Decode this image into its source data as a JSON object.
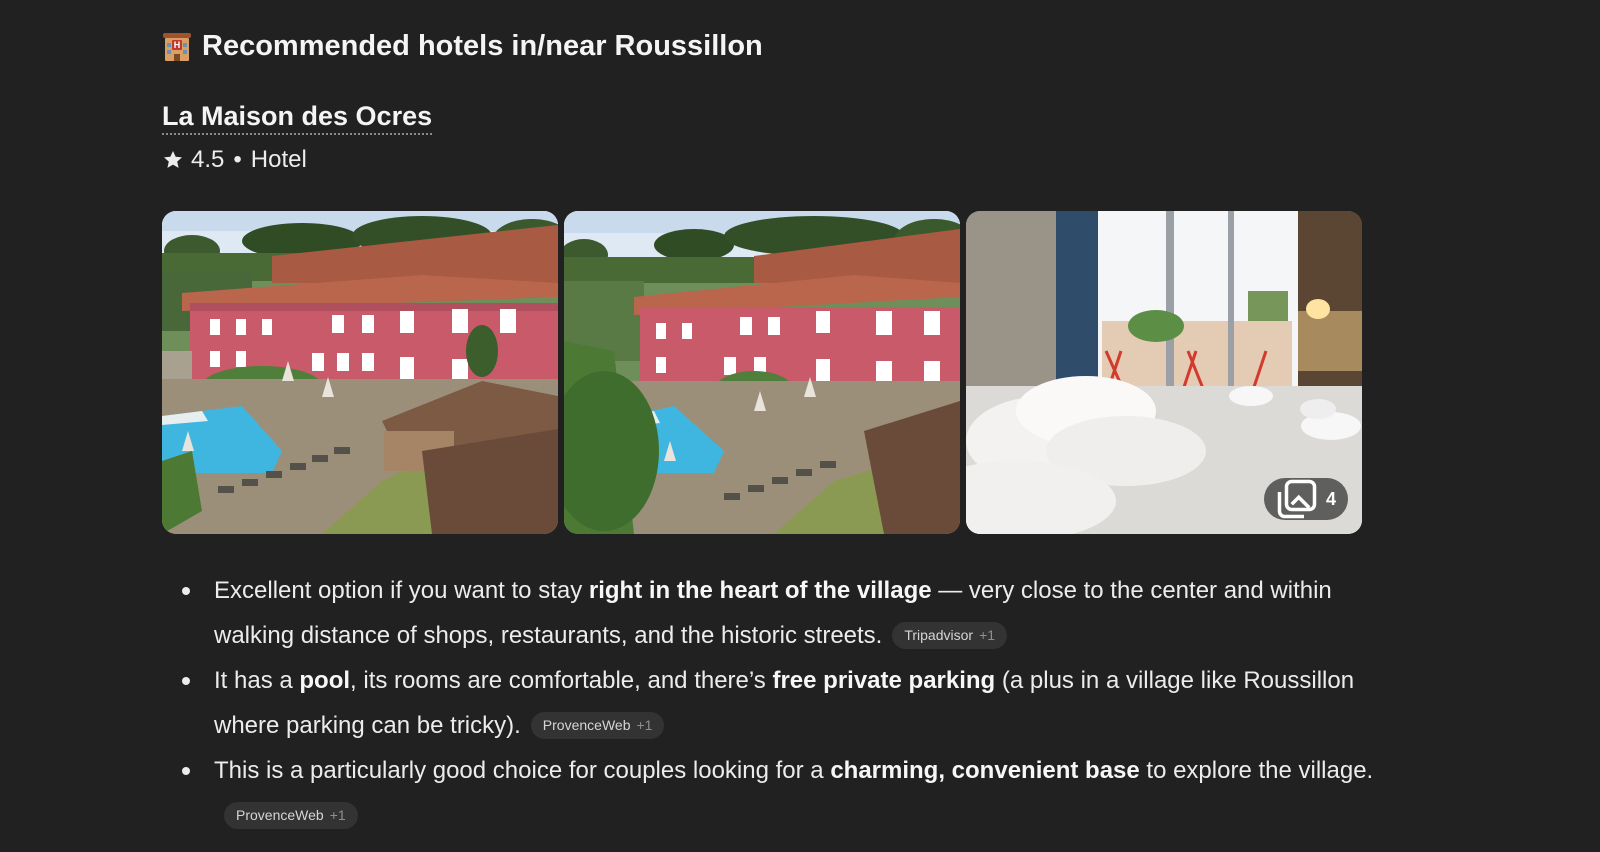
{
  "heading": {
    "icon": "hotel-emoji-icon",
    "text": "Recommended hotels in/near Roussillon"
  },
  "hotel": {
    "name": "La Maison des Ocres",
    "rating": "4.5",
    "separator": "•",
    "type": "Hotel",
    "photos": {
      "count": "4",
      "items": [
        "exterior-pool-view-1",
        "exterior-pool-view-2",
        "bedroom-view"
      ]
    }
  },
  "bullets": [
    {
      "parts": [
        {
          "t": "Excellent option if you want to stay ",
          "b": false
        },
        {
          "t": "right in the heart of the village",
          "b": true
        },
        {
          "t": " — very close to the center and within walking distance of shops, restaurants, and the historic streets.",
          "b": false
        }
      ],
      "citation": {
        "source": "Tripadvisor",
        "more": "+1"
      }
    },
    {
      "parts": [
        {
          "t": "It has a ",
          "b": false
        },
        {
          "t": "pool",
          "b": true
        },
        {
          "t": ", its rooms are comfortable, and there’s ",
          "b": false
        },
        {
          "t": "free private parking",
          "b": true
        },
        {
          "t": " (a plus in a village like Roussillon where parking can be tricky).",
          "b": false
        }
      ],
      "citation": {
        "source": "ProvenceWeb",
        "more": "+1"
      }
    },
    {
      "parts": [
        {
          "t": "This is a particularly good choice for couples looking for a ",
          "b": false
        },
        {
          "t": "charming, convenient base",
          "b": true
        },
        {
          "t": " to explore the village.",
          "b": false
        }
      ],
      "citation": {
        "source": "ProvenceWeb",
        "more": "+1"
      }
    }
  ],
  "colors": {
    "background": "#212121",
    "text": "#ececec",
    "building": "#c85a6a",
    "pool": "#3fb6e0"
  }
}
